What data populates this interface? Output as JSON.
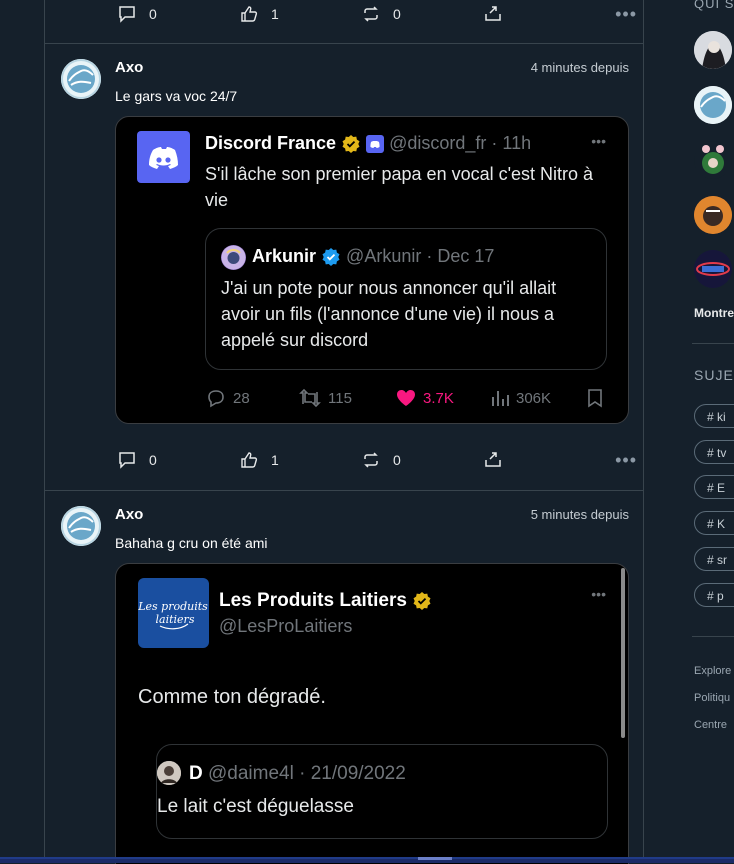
{
  "top_actions": {
    "comments": "0",
    "likes": "1",
    "shares": "0",
    "more": "•••"
  },
  "posts": [
    {
      "author": "Axo",
      "time": "4 minutes depuis",
      "text": "Le gars va voc 24/7",
      "embed": {
        "name": "Discord France",
        "handle": "@discord_fr · 11h",
        "more": "•••",
        "body": "S'il lâche son premier papa en vocal c'est Nitro à vie",
        "quote": {
          "name": "Arkunir",
          "handle": "@Arkunir · Dec 17",
          "body": "J'ai un pote pour nous annoncer qu'il allait avoir un fils (l'annonce d'une vie) il nous a appelé sur discord"
        },
        "stats": {
          "replies": "28",
          "retweets": "115",
          "likes": "3.7K",
          "views": "306K"
        }
      },
      "actions": {
        "comments": "0",
        "likes": "1",
        "shares": "0",
        "more": "•••"
      }
    },
    {
      "author": "Axo",
      "time": "5 minutes depuis",
      "text": "Bahaha g cru on été ami",
      "embed": {
        "logo_text": "Les produits laitiers",
        "name": "Les Produits Laitiers",
        "handle": "@LesProLaitiers",
        "more": "•••",
        "body": "Comme ton dégradé.",
        "quote": {
          "name": "D",
          "handle": "@daime4l · 21/09/2022",
          "body": "Le lait c'est déguelasse"
        }
      }
    }
  ],
  "sidebar": {
    "who_title": "QUI S",
    "show_more": "Montre",
    "topics_title": "SUJE",
    "tags": [
      "# ki",
      "# tv",
      "# E",
      "# K",
      "# sr",
      "# p"
    ],
    "footer": [
      "Explore",
      "Politiqu",
      "Centre"
    ]
  },
  "colors": {
    "background": "#15202b",
    "like_pink": "#f91880",
    "verified_gold": "#e2b719",
    "verified_blue": "#1d9bf0",
    "discord_blurple": "#5865f2"
  }
}
